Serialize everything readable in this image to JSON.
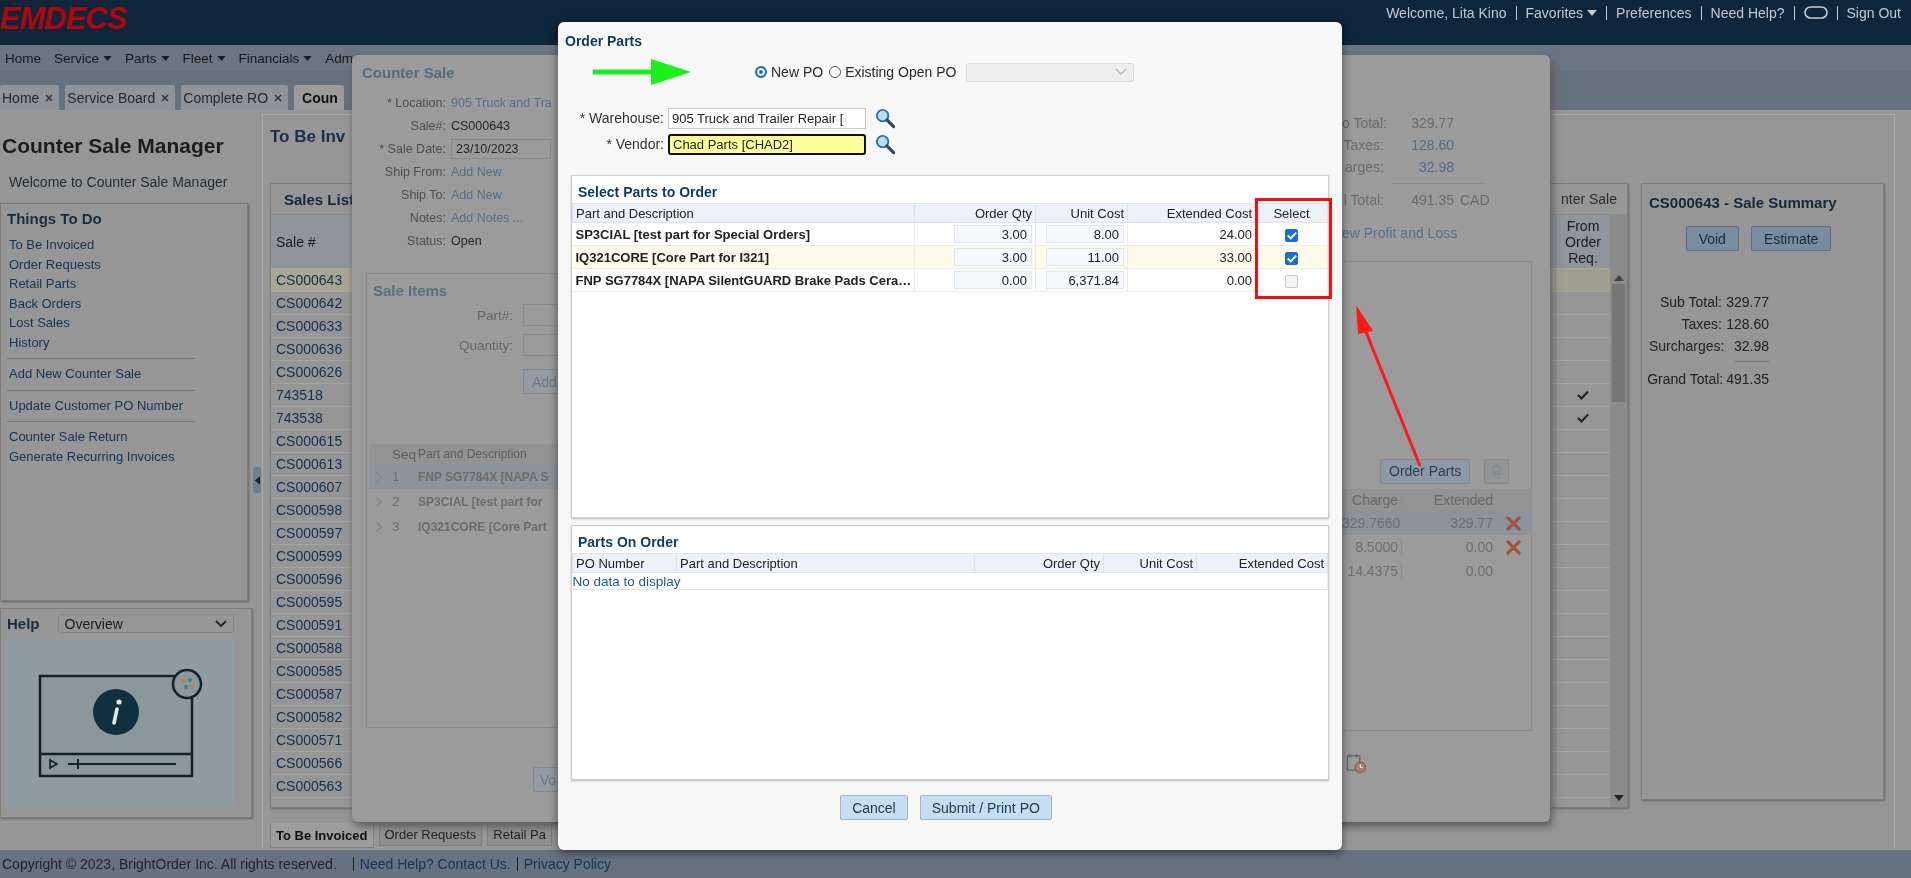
{
  "header": {
    "logo": "EMDECS",
    "links": [
      {
        "kind": "text",
        "label": "Welcome, Lita Kino"
      },
      {
        "kind": "menu",
        "label": "Favorites"
      },
      {
        "kind": "link",
        "label": "Preferences"
      },
      {
        "kind": "link",
        "label": "Need Help?"
      },
      {
        "kind": "chat"
      },
      {
        "kind": "link",
        "label": "Sign Out"
      }
    ]
  },
  "menu": [
    {
      "label": "Home",
      "dropdown": false
    },
    {
      "label": "Service",
      "dropdown": true
    },
    {
      "label": "Parts",
      "dropdown": true
    },
    {
      "label": "Fleet",
      "dropdown": true
    },
    {
      "label": "Financials",
      "dropdown": true
    },
    {
      "label": "Adm",
      "dropdown": false
    }
  ],
  "tabs": [
    {
      "label": "Home",
      "selected": false,
      "closable": true
    },
    {
      "label": "Service Board",
      "selected": false,
      "closable": true
    },
    {
      "label": "Complete RO",
      "selected": false,
      "closable": true
    },
    {
      "label": "Coun",
      "selected": true,
      "closable": false
    }
  ],
  "sidebar": {
    "title": "Counter Sale Manager",
    "welcome": "Welcome to Counter Sale Manager",
    "todo": {
      "title": "Things To Do",
      "groups": [
        [
          "To Be Invoiced",
          "Order Requests",
          "Retail Parts",
          "Back Orders",
          "Lost Sales",
          "History"
        ],
        [
          "Add New Counter Sale"
        ],
        [
          "Update Customer PO Number"
        ],
        [
          "Counter Sale Return",
          "Generate Recurring Invoices"
        ]
      ]
    },
    "help": {
      "title": "Help",
      "topic": "Overview"
    }
  },
  "sales": {
    "title": "To Be Inv",
    "list_title": "Sales List",
    "side_title": "nter Sale",
    "columns": [
      "Sale #",
      "From Order Req."
    ],
    "rows": [
      {
        "sale": "CS000643",
        "selected": true,
        "from_order_req": false
      },
      {
        "sale": "CS000642",
        "selected": false,
        "from_order_req": false
      },
      {
        "sale": "CS000633",
        "selected": false,
        "from_order_req": false
      },
      {
        "sale": "CS000636",
        "selected": false,
        "from_order_req": false
      },
      {
        "sale": "CS000626",
        "selected": false,
        "from_order_req": false
      },
      {
        "sale": "743518",
        "selected": false,
        "from_order_req": true
      },
      {
        "sale": "743538",
        "selected": false,
        "from_order_req": true
      },
      {
        "sale": "CS000615",
        "selected": false,
        "from_order_req": false
      },
      {
        "sale": "CS000613",
        "selected": false,
        "from_order_req": false
      },
      {
        "sale": "CS000607",
        "selected": false,
        "from_order_req": false
      },
      {
        "sale": "CS000598",
        "selected": false,
        "from_order_req": false
      },
      {
        "sale": "CS000597",
        "selected": false,
        "from_order_req": false
      },
      {
        "sale": "CS000599",
        "selected": false,
        "from_order_req": false
      },
      {
        "sale": "CS000596",
        "selected": false,
        "from_order_req": false
      },
      {
        "sale": "CS000595",
        "selected": false,
        "from_order_req": false
      },
      {
        "sale": "CS000591",
        "selected": false,
        "from_order_req": false
      },
      {
        "sale": "CS000588",
        "selected": false,
        "from_order_req": false
      },
      {
        "sale": "CS000585",
        "selected": false,
        "from_order_req": false
      },
      {
        "sale": "CS000587",
        "selected": false,
        "from_order_req": false
      },
      {
        "sale": "CS000582",
        "selected": false,
        "from_order_req": false
      },
      {
        "sale": "CS000571",
        "selected": false,
        "from_order_req": false
      },
      {
        "sale": "CS000566",
        "selected": false,
        "from_order_req": false
      },
      {
        "sale": "CS000563",
        "selected": false,
        "from_order_req": false
      }
    ],
    "bottom_tabs": [
      {
        "label": "To Be Invoiced",
        "selected": true
      },
      {
        "label": "Order Requests",
        "selected": false
      },
      {
        "label": "Retail Pa",
        "selected": false
      }
    ]
  },
  "summary": {
    "title": "CS000643 - Sale Summary",
    "buttons": [
      "Void",
      "Estimate"
    ],
    "totals": [
      {
        "label": "Sub Total:",
        "value": "329.77"
      },
      {
        "label": "Taxes:",
        "value": "128.60"
      },
      {
        "label": "Surcharges:",
        "value": "32.98"
      }
    ],
    "grand_total": {
      "label": "Grand Total:",
      "value": "491.35"
    }
  },
  "counter_sale": {
    "title": "Counter Sale",
    "fields": [
      {
        "label": "* Location:",
        "value": "905 Truck and Tra",
        "kind": "link"
      },
      {
        "label": "Sale#:",
        "value": "CS000643",
        "kind": "text"
      },
      {
        "label": "* Sale Date:",
        "value": "23/10/2023",
        "kind": "input"
      },
      {
        "label": "Ship From:",
        "value": "Add New",
        "kind": "link"
      },
      {
        "label": "Ship To:",
        "value": "Add New",
        "kind": "link"
      },
      {
        "label": "Notes:",
        "value": "Add Notes ...",
        "kind": "link"
      },
      {
        "label": "Status:",
        "value": "Open",
        "kind": "text"
      }
    ],
    "items": {
      "title": "Sale Items",
      "inputs": [
        "Part#:",
        "Quantity:"
      ],
      "add_button": "Add",
      "columns": [
        "Seq",
        "Part and Description",
        "Charge",
        "Extended"
      ],
      "rows": [
        {
          "seq": "1",
          "part": "FNP SG7784X [NAPA S",
          "charge": "329.7660",
          "extended": "329.77",
          "removable": true,
          "selected": true
        },
        {
          "seq": "2",
          "part": "SP3CIAL [test part for",
          "charge": "8.5000",
          "extended": "0.00",
          "removable": true,
          "selected": false
        },
        {
          "seq": "3",
          "part": "IQ321CORE [Core Part",
          "charge": "14.4375",
          "extended": "0.00",
          "removable": false,
          "selected": false
        }
      ]
    },
    "void_button": "Vo",
    "totals": [
      {
        "label": "o Total:",
        "value": "329.77",
        "kind": "text"
      },
      {
        "label": "Taxes:",
        "value": "128.60",
        "kind": "link"
      },
      {
        "label": "arges:",
        "value": "32.98",
        "kind": "link"
      }
    ],
    "grand_total": {
      "label": "l Total:",
      "value": "491.35",
      "currency": "CAD"
    },
    "profit_link": "ew Profit and Loss",
    "order_parts_button": "Order Parts"
  },
  "order_parts": {
    "title": "Order Parts",
    "po_options": [
      {
        "label": "New PO",
        "selected": true
      },
      {
        "label": "Existing Open PO",
        "selected": false
      }
    ],
    "warehouse": {
      "label": "* Warehouse:",
      "value": "905 Truck and Trailer Repair ["
    },
    "vendor": {
      "label": "* Vendor:",
      "value": "Chad Parts [CHAD2]",
      "focused": true
    },
    "select_parts": {
      "title": "Select Parts to Order",
      "columns": [
        "Part and Description",
        "Order Qty",
        "Unit Cost",
        "Extended Cost",
        "Select"
      ],
      "rows": [
        {
          "part": "SP3CIAL [test part for Special Orders]",
          "qty": "3.00",
          "unit_cost": "8.00",
          "extended": "24.00",
          "checked": true,
          "selected": false
        },
        {
          "part": "IQ321CORE [Core Part for I321]",
          "qty": "3.00",
          "unit_cost": "11.00",
          "extended": "33.00",
          "checked": true,
          "selected": true
        },
        {
          "part": "FNP SG7784X [NAPA SilentGUARD Brake Pads Cera…",
          "qty": "0.00",
          "unit_cost": "6,371.84",
          "extended": "0.00",
          "checked": false,
          "selected": false
        }
      ]
    },
    "parts_on_order": {
      "title": "Parts On Order",
      "columns": [
        "PO Number",
        "Part and Description",
        "Order Qty",
        "Unit Cost",
        "Extended Cost"
      ],
      "empty": "No data to display"
    },
    "buttons": [
      "Cancel",
      "Submit / Print PO"
    ]
  },
  "footer": {
    "copyright": "Copyright © 2023, BrightOrder Inc. All rights reserved.",
    "links": [
      "Need Help? Contact Us.",
      "Privacy Policy"
    ]
  }
}
